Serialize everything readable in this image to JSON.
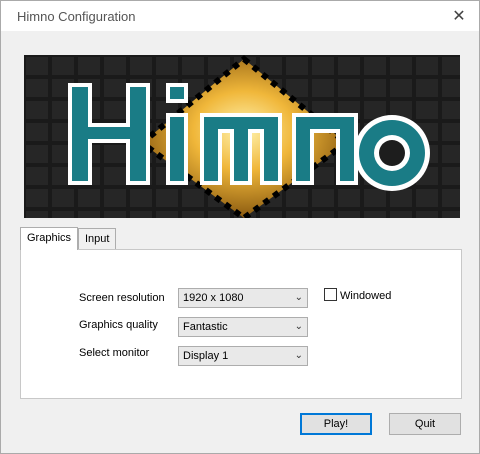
{
  "window": {
    "title": "Himno Configuration",
    "close_glyph": "✕"
  },
  "banner": {
    "logo_text": "Himno"
  },
  "tabs": [
    {
      "label": "Graphics",
      "active": true
    },
    {
      "label": "Input",
      "active": false
    }
  ],
  "graphics": {
    "resolution": {
      "label": "Screen resolution",
      "value": "1920 x 1080"
    },
    "quality": {
      "label": "Graphics quality",
      "value": "Fantastic"
    },
    "monitor": {
      "label": "Select monitor",
      "value": "Display 1"
    },
    "windowed": {
      "label": "Windowed",
      "checked": false
    }
  },
  "buttons": {
    "play": "Play!",
    "quit": "Quit"
  },
  "colors": {
    "accent": "#0078d7",
    "logo_fill": "#1a7c86",
    "logo_glow": "#f0b73a"
  }
}
